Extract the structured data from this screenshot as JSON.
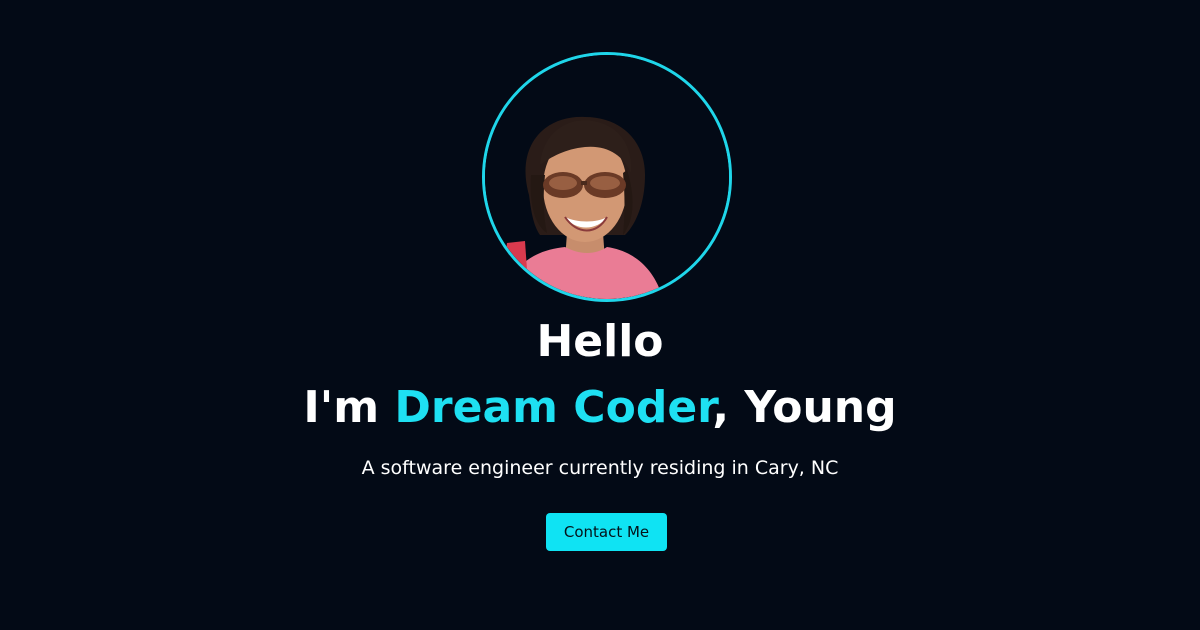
{
  "profile": {
    "photo_alt": "Profile photo"
  },
  "hero": {
    "greeting": "Hello",
    "intro_prefix": "I'm ",
    "intro_highlight": "Dream Coder",
    "intro_suffix": ", Young",
    "tagline": "A software engineer currently residing in Cary, NC",
    "contact_label": "Contact Me"
  },
  "colors": {
    "background": "#030a16",
    "accent": "#1ee0f2",
    "ring": "#1fd6ea",
    "button": "#0fe3f3",
    "text": "#ffffff"
  }
}
